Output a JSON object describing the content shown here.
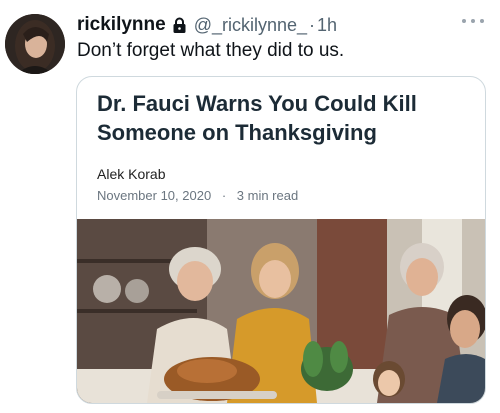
{
  "tweet": {
    "display_name": "rickilynne",
    "handle": "@_rickilynne_",
    "separator": "·",
    "time": "1h",
    "text": "Don’t forget what they did to us."
  },
  "card": {
    "title": "Dr. Fauci Warns You Could Kill Someone on Thanksgiving",
    "author": "Alek Korab",
    "date": "November 10, 2020",
    "meta_separator": "·",
    "read_time": "3 min read"
  },
  "icons": {
    "avatar": "user-avatar",
    "lock": "lock-icon",
    "more": "more-options-icon"
  },
  "colors": {
    "text_primary": "#0f1419",
    "text_secondary": "#536471",
    "card_border": "#cfd9de"
  }
}
